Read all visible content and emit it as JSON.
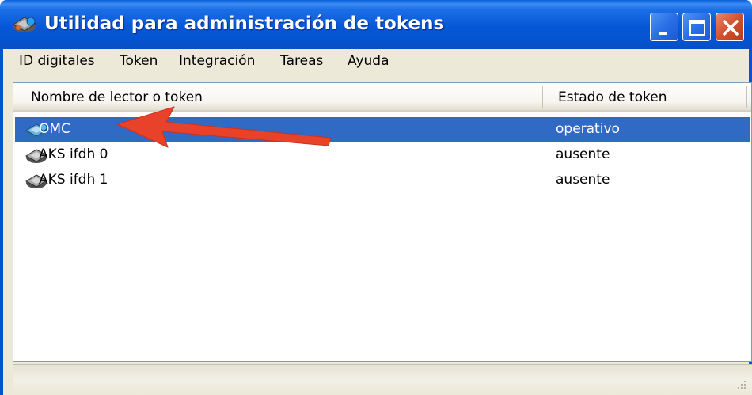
{
  "window": {
    "title": "Utilidad para administración de tokens",
    "icon": "token-reader-icon"
  },
  "window_buttons": {
    "minimize": "minimize-icon",
    "maximize": "maximize-icon",
    "close": "close-icon"
  },
  "menu": {
    "items": [
      "ID digitales",
      "Token",
      "Integración",
      "Tareas",
      "Ayuda"
    ]
  },
  "list": {
    "columns": [
      "Nombre de lector o token",
      "Estado de token"
    ],
    "rows": [
      {
        "name": "OMC",
        "status": "operativo",
        "selected": true
      },
      {
        "name": "AKS ifdh 0",
        "status": "ausente",
        "selected": false
      },
      {
        "name": "AKS ifdh 1",
        "status": "ausente",
        "selected": false
      }
    ]
  },
  "colors": {
    "titlebar": "#0553cf",
    "selection": "#316ac5",
    "annotation_arrow": "#e8432a"
  }
}
